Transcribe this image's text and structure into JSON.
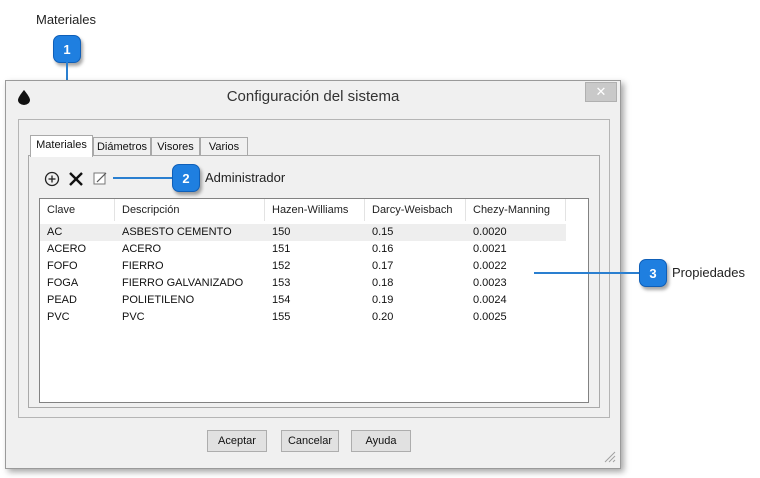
{
  "callouts": [
    {
      "number": "1",
      "label": "Materiales"
    },
    {
      "number": "2",
      "label": "Administrador"
    },
    {
      "number": "3",
      "label": "Propiedades"
    }
  ],
  "window": {
    "title": "Configuración del sistema",
    "close_glyph": "✕"
  },
  "tabs": [
    {
      "label": "Materiales",
      "active": true
    },
    {
      "label": "Diámetros",
      "active": false
    },
    {
      "label": "Visores",
      "active": false
    },
    {
      "label": "Varios",
      "active": false
    }
  ],
  "toolbar": {
    "add_icon": "add-circle-icon",
    "delete_icon": "x-delete-icon",
    "edit_icon": "edit-icon"
  },
  "table": {
    "columns": [
      "Clave",
      "Descripción",
      "Hazen-Williams",
      "Darcy-Weisbach",
      "Chezy-Manning"
    ],
    "rows": [
      [
        "AC",
        "ASBESTO CEMENTO",
        "150",
        "0.15",
        "0.0020"
      ],
      [
        "ACERO",
        "ACERO",
        "151",
        "0.16",
        "0.0021"
      ],
      [
        "FOFO",
        "FIERRO",
        "152",
        "0.17",
        "0.0022"
      ],
      [
        "FOGA",
        "FIERRO GALVANIZADO",
        "153",
        "0.18",
        "0.0023"
      ],
      [
        "PEAD",
        "POLIETILENO",
        "154",
        "0.19",
        "0.0024"
      ],
      [
        "PVC",
        "PVC",
        "155",
        "0.20",
        "0.0025"
      ]
    ],
    "selected_row": 0
  },
  "buttons": {
    "accept": "Aceptar",
    "cancel": "Cancelar",
    "help": "Ayuda"
  },
  "colors": {
    "callout_badge": "#1f7fe0",
    "callout_line": "#2a7fd0"
  }
}
